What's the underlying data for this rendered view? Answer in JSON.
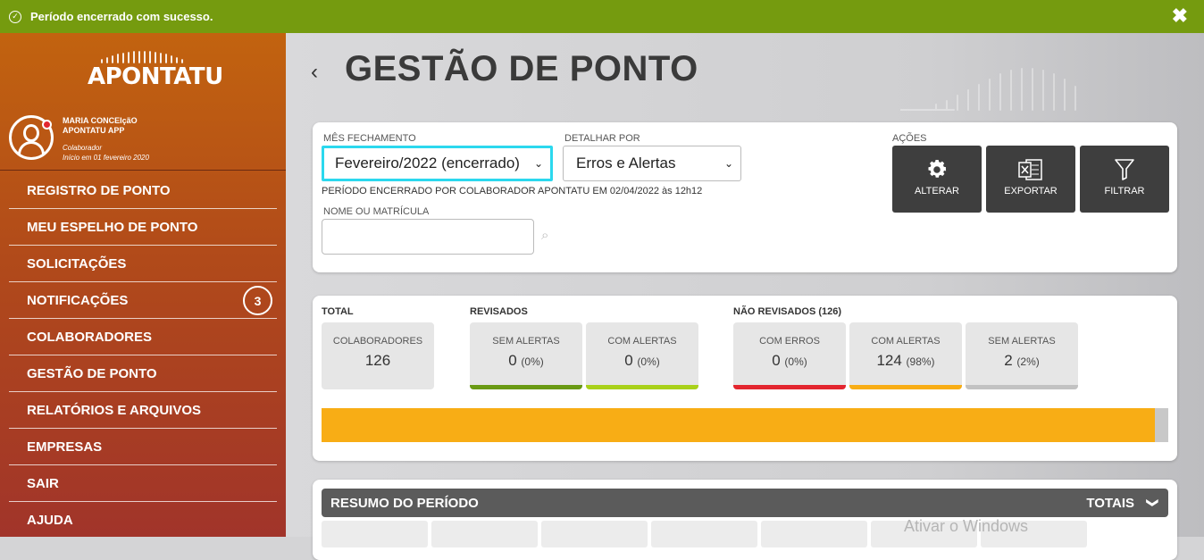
{
  "notification": {
    "message": "Período encerrado com sucesso.",
    "close_label": "✖"
  },
  "brand": {
    "name": "APONTATU"
  },
  "user": {
    "name_line1": "MARIA CONCEIçãO",
    "name_line2": "APONTATU APP",
    "role": "Colaborador",
    "since": "Início em 01 fevereiro 2020"
  },
  "menu": [
    {
      "label": "REGISTRO DE PONTO"
    },
    {
      "label": "MEU ESPELHO DE PONTO"
    },
    {
      "label": "SOLICITAÇÕES"
    },
    {
      "label": "NOTIFICAÇÕES",
      "badge": "3"
    },
    {
      "label": "COLABORADORES"
    },
    {
      "label": "GESTÃO DE PONTO"
    },
    {
      "label": "RELATÓRIOS E ARQUIVOS"
    },
    {
      "label": "EMPRESAS"
    },
    {
      "label": "SAIR"
    },
    {
      "label": "AJUDA"
    }
  ],
  "page": {
    "back_icon": "‹",
    "title": "GESTÃO DE PONTO"
  },
  "filters": {
    "mes_label": "MÊS FECHAMENTO",
    "mes_value": "Fevereiro/2022 (encerrado)",
    "detalhar_label": "DETALHAR POR",
    "detalhar_value": "Erros e Alertas",
    "period_note": "PERÍODO ENCERRADO POR COLABORADOR APONTATU EM 02/04/2022 às 12h12",
    "nome_label": "NOME OU MATRÍCULA",
    "nome_value": "",
    "nome_placeholder": ""
  },
  "actions": {
    "label": "AÇÕES",
    "buttons": [
      {
        "label": "ALTERAR",
        "icon": "gear-icon"
      },
      {
        "label": "EXPORTAR",
        "icon": "excel-icon"
      },
      {
        "label": "FILTRAR",
        "icon": "filter-icon"
      }
    ]
  },
  "stats": {
    "total_label": "TOTAL",
    "revisados_label": "REVISADOS",
    "nao_revisados_label": "NÃO REVISADOS (126)",
    "cards": [
      {
        "label": "COLABORADORES",
        "value": "126",
        "pct": "",
        "color": ""
      },
      {
        "label": "SEM ALERTAS",
        "value": "0",
        "pct": "(0%)",
        "color": "#6a9a14"
      },
      {
        "label": "COM ALERTAS",
        "value": "0",
        "pct": "(0%)",
        "color": "#a9d11a"
      },
      {
        "label": "COM ERROS",
        "value": "0",
        "pct": "(0%)",
        "color": "#e3262f"
      },
      {
        "label": "COM ALERTAS",
        "value": "124",
        "pct": "(98%)",
        "color": "#f8ad15"
      },
      {
        "label": "SEM ALERTAS",
        "value": "2",
        "pct": "(2%)",
        "color": "#c2c2c2"
      }
    ],
    "progress_fraction": 0.984
  },
  "resumo": {
    "title": "RESUMO DO PERÍODO",
    "totals_label": "TOTAIS",
    "chevron": "❯"
  },
  "watermark": "Ativar o Windows"
}
